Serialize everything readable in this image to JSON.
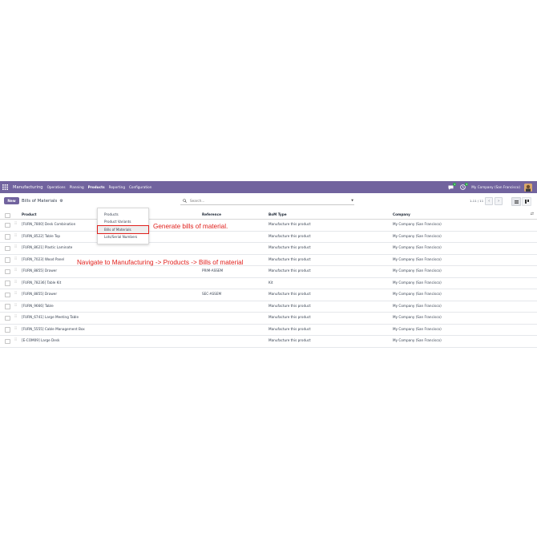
{
  "navbar": {
    "brand": "Manufacturing",
    "menus": [
      "Operations",
      "Planning",
      "Products",
      "Reporting",
      "Configuration"
    ],
    "active_menu": "Products",
    "messages_badge": "1",
    "activity_badge": "4",
    "company": "My Company (San Francisco)",
    "accent_color": "#71639e"
  },
  "control": {
    "new_label": "New",
    "breadcrumb": "Bills of Materials",
    "search_placeholder": "Search...",
    "pager": "1-11 / 11"
  },
  "dropdown": {
    "items": [
      "Products",
      "Product Variants",
      "Bills of Materials",
      "Lots/Serial Numbers"
    ],
    "highlighted": "Bills of Materials"
  },
  "table": {
    "headers": {
      "product": "Product",
      "reference": "Reference",
      "bom_type": "BoM Type",
      "company": "Company"
    },
    "rows": [
      {
        "product": "[FURN_7800] Desk Combination",
        "reference": "",
        "bom_type": "Manufacture this product",
        "company": "My Company (San Francisco)"
      },
      {
        "product": "[FURN_8522] Table Top",
        "reference": "",
        "bom_type": "Manufacture this product",
        "company": "My Company (San Francisco)"
      },
      {
        "product": "[FURN_8621] Plastic Laminate",
        "reference": "",
        "bom_type": "Manufacture this product",
        "company": "My Company (San Francisco)"
      },
      {
        "product": "[FURN_7023] Wood Panel",
        "reference": "",
        "bom_type": "Manufacture this product",
        "company": "My Company (San Francisco)"
      },
      {
        "product": "[FURN_8855] Drawer",
        "reference": "PRIM-ASSEM",
        "bom_type": "Manufacture this product",
        "company": "My Company (San Francisco)"
      },
      {
        "product": "[FURN_78236] Table Kit",
        "reference": "",
        "bom_type": "Kit",
        "company": "My Company (San Francisco)"
      },
      {
        "product": "[FURN_8855] Drawer",
        "reference": "SEC-ASSEM",
        "bom_type": "Manufacture this product",
        "company": "My Company (San Francisco)"
      },
      {
        "product": "[FURN_9666] Table",
        "reference": "",
        "bom_type": "Manufacture this product",
        "company": "My Company (San Francisco)"
      },
      {
        "product": "[FURN_6741] Large Meeting Table",
        "reference": "",
        "bom_type": "Manufacture this product",
        "company": "My Company (San Francisco)"
      },
      {
        "product": "[FURN_5555] Cable Management Box",
        "reference": "",
        "bom_type": "Manufacture this product",
        "company": "My Company (San Francisco)"
      },
      {
        "product": "[E-COM09] Large Desk",
        "reference": "",
        "bom_type": "Manufacture this product",
        "company": "My Company (San Francisco)"
      }
    ]
  },
  "annotations": {
    "step_title": "Generate bills of material.",
    "instruction": "Navigate to Manufacturing -> Products -> Bills of material",
    "color": "#e0201c"
  }
}
